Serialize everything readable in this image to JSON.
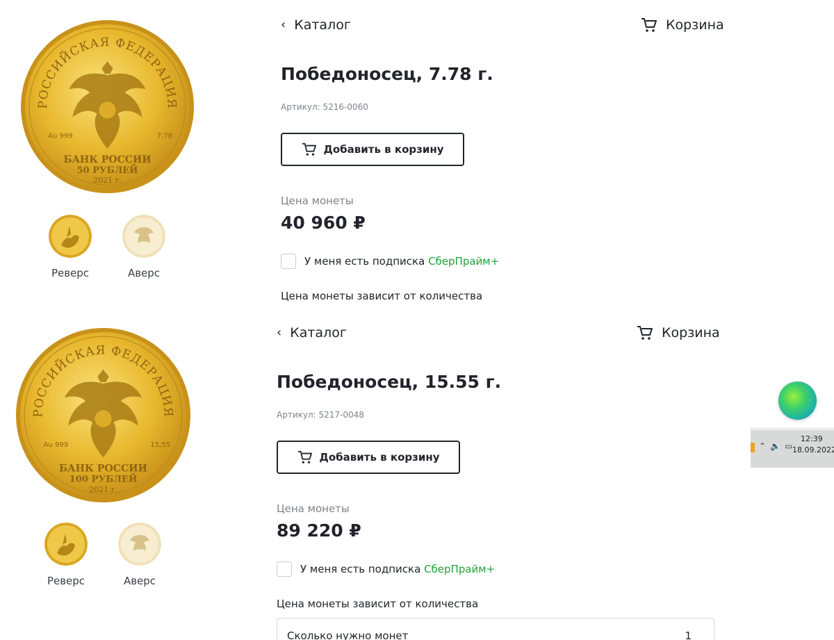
{
  "products": [
    {
      "back_label": "Каталог",
      "cart_label": "Корзина",
      "title": "Победоносец, 7.78 г.",
      "sku": "Артикул: 5216-0060",
      "add_to_cart": "Добавить в корзину",
      "price_label": "Цена монеты",
      "price": "40 960 ₽",
      "subscription_text": "У меня есть подписка",
      "subscription_brand": "СберПрайм+",
      "qty_note": "Цена монеты зависит от количества",
      "coin": {
        "top_text": "РОССИЙСКАЯ ФЕДЕРАЦИЯ",
        "bank": "БАНК РОССИИ",
        "denomination": "50 РУБЛЕЙ",
        "year": "2021 г.",
        "metal": "Au 999",
        "weight": "7,78"
      },
      "thumbs": [
        {
          "label": "Реверс"
        },
        {
          "label": "Аверс"
        }
      ]
    },
    {
      "back_label": "Каталог",
      "cart_label": "Корзина",
      "title": "Победоносец, 15.55 г.",
      "sku": "Артикул: 5217-0048",
      "add_to_cart": "Добавить в корзину",
      "price_label": "Цена монеты",
      "price": "89 220 ₽",
      "subscription_text": "У меня есть подписка",
      "subscription_brand": "СберПрайм+",
      "qty_note": "Цена монеты зависит от количества",
      "qty_field_label": "Сколько нужно монет",
      "qty_field_value": "1",
      "coin": {
        "top_text": "РОССИЙСКАЯ ФЕДЕРАЦИЯ",
        "bank": "БАНК РОССИИ",
        "denomination": "100 РУБЛЕЙ",
        "year": "2021 г.",
        "metal": "Au 999",
        "weight": "15,55"
      },
      "thumbs": [
        {
          "label": "Реверс"
        },
        {
          "label": "Аверс"
        }
      ]
    }
  ],
  "taskbar": {
    "time": "12:39",
    "date": "18.09.2022"
  },
  "colors": {
    "accent_green": "#21a038",
    "text": "#21242a",
    "muted": "#7d838a",
    "gold": "#e8b82e"
  }
}
